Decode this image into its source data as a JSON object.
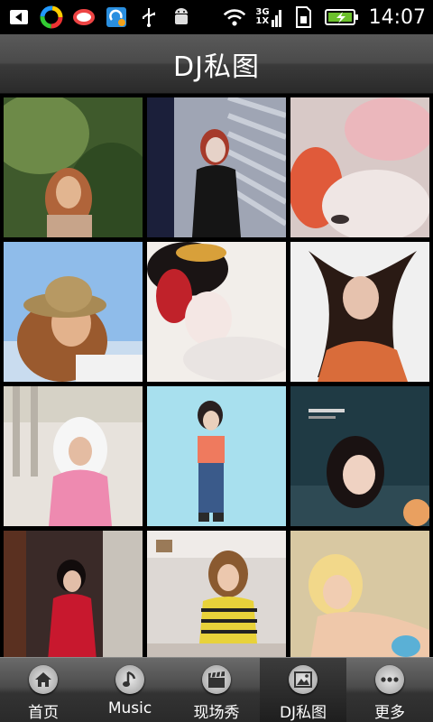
{
  "status_bar": {
    "time": "14:07",
    "network_top": "3G",
    "network_bottom": "1X"
  },
  "header": {
    "title": "DJ私图"
  },
  "gallery": {
    "photos": [
      {
        "id": 1
      },
      {
        "id": 2
      },
      {
        "id": 3
      },
      {
        "id": 4
      },
      {
        "id": 5
      },
      {
        "id": 6
      },
      {
        "id": 7
      },
      {
        "id": 8
      },
      {
        "id": 9
      },
      {
        "id": 10
      },
      {
        "id": 11
      },
      {
        "id": 12
      }
    ]
  },
  "tabs": [
    {
      "label": "首页",
      "icon": "home-icon"
    },
    {
      "label": "Music",
      "icon": "music-note-icon"
    },
    {
      "label": "现场秀",
      "icon": "clapperboard-icon"
    },
    {
      "label": "DJ私图",
      "icon": "picture-icon",
      "active": true
    },
    {
      "label": "更多",
      "icon": "more-dots-icon"
    }
  ]
}
